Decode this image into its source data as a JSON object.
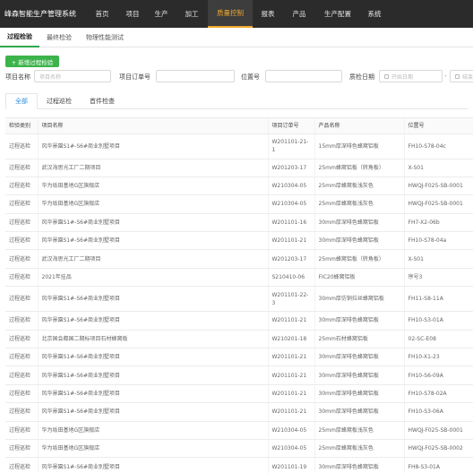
{
  "app": {
    "title": "峰森智能生产管理系统"
  },
  "nav": [
    {
      "label": "首页",
      "active": false
    },
    {
      "label": "项目",
      "active": false
    },
    {
      "label": "生产",
      "active": false
    },
    {
      "label": "加工",
      "active": false
    },
    {
      "label": "质量控制",
      "active": true
    },
    {
      "label": "报表",
      "active": false
    },
    {
      "label": "产品",
      "active": false
    },
    {
      "label": "生产配置",
      "active": false
    },
    {
      "label": "系统",
      "active": false
    }
  ],
  "subnav": [
    {
      "label": "过程检验",
      "active": true
    },
    {
      "label": "最终检验",
      "active": false
    },
    {
      "label": "物理性能测试",
      "active": false
    }
  ],
  "actions": {
    "add_label": "+ 新增过程检验"
  },
  "filters": {
    "project_name_label": "项目名称",
    "project_name_placeholder": "项目名称",
    "order_no_label": "项目订单号",
    "order_no_placeholder": "",
    "position_label": "位置号",
    "position_placeholder": "",
    "date_label": "质检日期",
    "start_date_placeholder": "开始日期",
    "date_separator": "-",
    "end_date_placeholder": "结束"
  },
  "tabs": [
    {
      "label": "全部",
      "active": true
    },
    {
      "label": "过程巡检",
      "active": false
    },
    {
      "label": "首件检查",
      "active": false
    }
  ],
  "table": {
    "headers": [
      "检验类别",
      "项目名称",
      "项目订单号",
      "产品名称",
      "位置号"
    ],
    "rows": [
      {
        "type": "过程巡检",
        "project": "风华景園S1#-S6#商业別墅项目",
        "order": "W201101-21-1",
        "product": "15mm厚深啡色蜂窝铝板",
        "position": "FH10-S78-04c"
      },
      {
        "type": "过程巡检",
        "project": "武汉海思光工厂二期项目",
        "order": "W201203-17",
        "product": "25mm蜂窝铝板（转角板）",
        "position": "X-S01"
      },
      {
        "type": "过程巡检",
        "project": "华为坂田基地G区旗舰店",
        "order": "W210304-05",
        "product": "25mm厚蜂窝板浅灰色",
        "position": "HWQJ-F025-SB-0001"
      },
      {
        "type": "过程巡检",
        "project": "华为坂田基地G区旗舰店",
        "order": "W210304-05",
        "product": "25mm厚蜂窝板浅灰色",
        "position": "HWQJ-F025-SB-0001"
      },
      {
        "type": "过程巡检",
        "project": "风华景園S1#-S6#商业別墅项目",
        "order": "W201101-16",
        "product": "30mm厚深啡色蜂窝铝板",
        "position": "FH7-X2-06b"
      },
      {
        "type": "过程巡检",
        "project": "风华景園S1#-S6#商业別墅项目",
        "order": "W201101-21",
        "product": "30mm厚深啡色蜂窝铝板",
        "position": "FH10-S78-04a"
      },
      {
        "type": "过程巡检",
        "project": "武汉海思光工厂二期项目",
        "order": "W201203-17",
        "product": "25mm蜂窝铝板（转角板）",
        "position": "X-S01"
      },
      {
        "type": "过程巡检",
        "project": "2021年挂品",
        "order": "S210410-06",
        "product": "FIC20蜂窝铝板",
        "position": "序号3"
      },
      {
        "type": "过程巡检",
        "project": "风华景園S1#-S6#商业別墅项目",
        "order": "W201101-22-3",
        "product": "30mm厚仿铜拉丝蜂窝铝板",
        "position": "FH11-S8-11A"
      },
      {
        "type": "过程巡检",
        "project": "风华景園S1#-S6#商业別墅项目",
        "order": "W201101-21",
        "product": "30mm厚深啡色蜂窝铝板",
        "position": "FH10-S3-01A"
      },
      {
        "type": "过程巡检",
        "project": "北京国会都国二期标项目石材蜂窝板",
        "order": "W210201-18",
        "product": "25mm石材蜂窝铝板",
        "position": "02-SC-E08"
      },
      {
        "type": "过程巡检",
        "project": "风华景園S1#-S6#商业別墅项目",
        "order": "W201101-21",
        "product": "30mm厚深啡色蜂窝铝板",
        "position": "FH10-X1-23"
      },
      {
        "type": "过程巡检",
        "project": "风华景園S1#-S6#商业別墅项目",
        "order": "W201101-21",
        "product": "30mm厚深啡色蜂窝铝板",
        "position": "FH10-S6-09A"
      },
      {
        "type": "过程巡检",
        "project": "风华景園S1#-S6#商业別墅项目",
        "order": "W201101-21",
        "product": "30mm厚深啡色蜂窝铝板",
        "position": "FH10-S78-02A"
      },
      {
        "type": "过程巡检",
        "project": "风华景園S1#-S6#商业別墅项目",
        "order": "W201101-21",
        "product": "30mm厚深啡色蜂窝铝板",
        "position": "FH10-S3-06A"
      },
      {
        "type": "过程巡检",
        "project": "华为坂田基地G区旗舰店",
        "order": "W210304-05",
        "product": "25mm厚蜂窝板浅灰色",
        "position": "HWQJ-F025-SB-0001"
      },
      {
        "type": "过程巡检",
        "project": "华为坂田基地G区旗舰店",
        "order": "W210304-05",
        "product": "25mm厚蜂窝板浅灰色",
        "position": "HWQJ-F025-SB-0002"
      },
      {
        "type": "过程巡检",
        "project": "风华景園S1#-S6#商业別墅项目",
        "order": "W201101-19",
        "product": "30mm厚深啡色蜂窝铝板",
        "position": "FH8-S3-01A"
      }
    ]
  },
  "colors": {
    "accent": "#f0a92e",
    "primary_button": "#3cb44b",
    "tab_active": "#2f8fe0",
    "topbar": "#2b2b2b"
  }
}
